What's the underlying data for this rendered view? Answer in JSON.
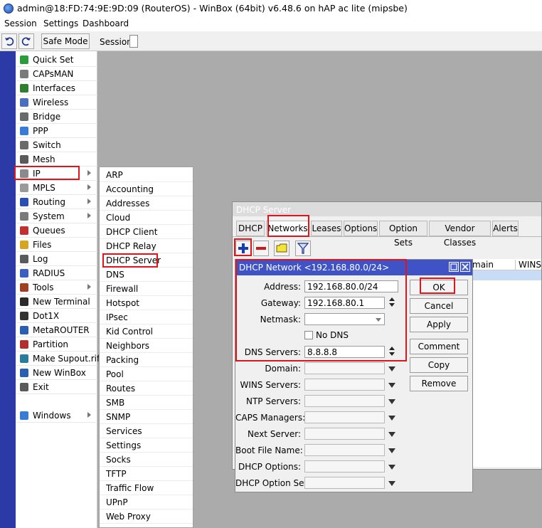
{
  "window": {
    "title": "admin@18:FD:74:9E:9D:09 (RouterOS) - WinBox (64bit) v6.48.6 on hAP ac lite (mipsbe)"
  },
  "menubar": [
    "Session",
    "Settings",
    "Dashboard"
  ],
  "toolbar": {
    "undo_icon": "undo-icon",
    "redo_icon": "redo-icon",
    "safe_mode": "Safe Mode",
    "session_label": "Session:"
  },
  "sidebar": {
    "items": [
      {
        "label": "Quick Set",
        "icon": "quick-set-icon",
        "submenu": false
      },
      {
        "label": "CAPsMAN",
        "icon": "capsman-icon",
        "submenu": false
      },
      {
        "label": "Interfaces",
        "icon": "interfaces-icon",
        "submenu": false
      },
      {
        "label": "Wireless",
        "icon": "wireless-icon",
        "submenu": false
      },
      {
        "label": "Bridge",
        "icon": "bridge-icon",
        "submenu": false
      },
      {
        "label": "PPP",
        "icon": "ppp-icon",
        "submenu": false
      },
      {
        "label": "Switch",
        "icon": "switch-icon",
        "submenu": false
      },
      {
        "label": "Mesh",
        "icon": "mesh-icon",
        "submenu": false
      },
      {
        "label": "IP",
        "icon": "ip-icon",
        "submenu": true
      },
      {
        "label": "MPLS",
        "icon": "mpls-icon",
        "submenu": true
      },
      {
        "label": "Routing",
        "icon": "routing-icon",
        "submenu": true
      },
      {
        "label": "System",
        "icon": "system-icon",
        "submenu": true
      },
      {
        "label": "Queues",
        "icon": "queues-icon",
        "submenu": false
      },
      {
        "label": "Files",
        "icon": "files-icon",
        "submenu": false
      },
      {
        "label": "Log",
        "icon": "log-icon",
        "submenu": false
      },
      {
        "label": "RADIUS",
        "icon": "radius-icon",
        "submenu": false
      },
      {
        "label": "Tools",
        "icon": "tools-icon",
        "submenu": true
      },
      {
        "label": "New Terminal",
        "icon": "terminal-icon",
        "submenu": false
      },
      {
        "label": "Dot1X",
        "icon": "dot1x-icon",
        "submenu": false
      },
      {
        "label": "MetaROUTER",
        "icon": "metarouter-icon",
        "submenu": false
      },
      {
        "label": "Partition",
        "icon": "partition-icon",
        "submenu": false
      },
      {
        "label": "Make Supout.rif",
        "icon": "supout-icon",
        "submenu": false
      },
      {
        "label": "New WinBox",
        "icon": "winbox-icon",
        "submenu": false
      },
      {
        "label": "Exit",
        "icon": "exit-icon",
        "submenu": false
      },
      {
        "label": "Windows",
        "icon": "windows-icon",
        "submenu": true
      }
    ]
  },
  "ip_submenu": [
    "ARP",
    "Accounting",
    "Addresses",
    "Cloud",
    "DHCP Client",
    "DHCP Relay",
    "DHCP Server",
    "DNS",
    "Firewall",
    "Hotspot",
    "IPsec",
    "Kid Control",
    "Neighbors",
    "Packing",
    "Pool",
    "Routes",
    "SMB",
    "SNMP",
    "Services",
    "Settings",
    "Socks",
    "TFTP",
    "Traffic Flow",
    "UPnP",
    "Web Proxy"
  ],
  "dhcp_window": {
    "title": "DHCP Server",
    "tabs": [
      "DHCP",
      "Networks",
      "Leases",
      "Options",
      "Option Sets",
      "Vendor Classes",
      "Alerts"
    ],
    "active_tab": "Networks",
    "toolbar_icons": [
      "add-icon",
      "remove-icon",
      "comment-icon",
      "filter-icon"
    ],
    "columns": [
      "main",
      "WINS S"
    ]
  },
  "network_dialog": {
    "title": "DHCP Network <192.168.80.0/24>",
    "fields": {
      "address": {
        "label": "Address:",
        "value": "192.168.80.0/24"
      },
      "gateway": {
        "label": "Gateway:",
        "value": "192.168.80.1"
      },
      "netmask": {
        "label": "Netmask:",
        "value": ""
      },
      "no_dns": {
        "label": "No DNS",
        "checked": false
      },
      "dns_servers": {
        "label": "DNS Servers:",
        "value": "8.8.8.8"
      },
      "domain": {
        "label": "Domain:",
        "value": ""
      },
      "wins_servers": {
        "label": "WINS Servers:",
        "value": ""
      },
      "ntp_servers": {
        "label": "NTP Servers:",
        "value": ""
      },
      "caps_managers": {
        "label": "CAPS Managers:",
        "value": ""
      },
      "next_server": {
        "label": "Next Server:",
        "value": ""
      },
      "boot_file_name": {
        "label": "Boot File Name:",
        "value": ""
      },
      "dhcp_options": {
        "label": "DHCP Options:",
        "value": ""
      },
      "dhcp_option_set": {
        "label": "DHCP Option Set:",
        "value": ""
      }
    },
    "buttons": [
      "OK",
      "Cancel",
      "Apply",
      "Comment",
      "Copy",
      "Remove"
    ]
  }
}
